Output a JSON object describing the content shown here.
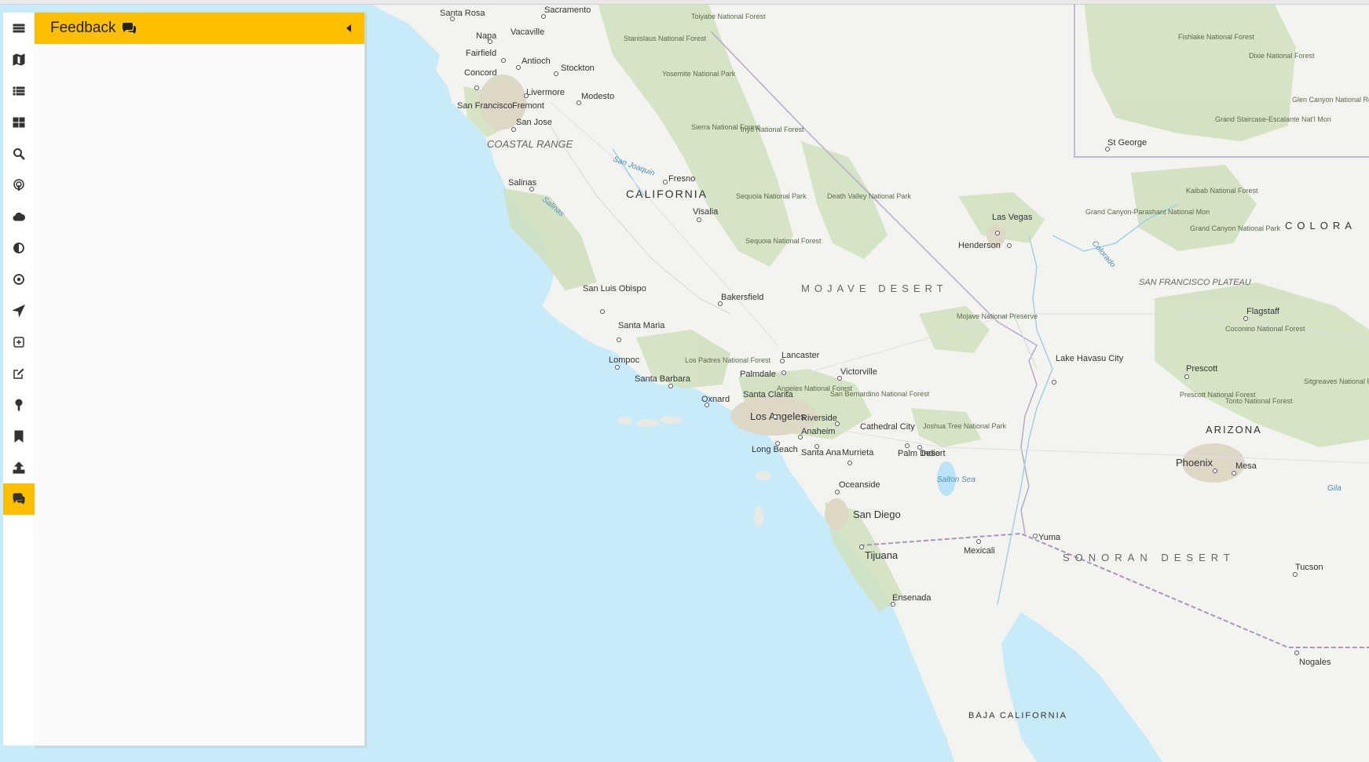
{
  "panel": {
    "title": "Feedback",
    "collapse_icon": "caret-left-icon",
    "title_icon": "comments-icon"
  },
  "toolbar": {
    "active_color": "#fdbf00",
    "items": [
      {
        "icon": "hamburger-menu-icon"
      },
      {
        "icon": "map-icon"
      },
      {
        "icon": "list-icon"
      },
      {
        "icon": "grid-icon"
      },
      {
        "icon": "search-icon"
      },
      {
        "icon": "podcast-icon"
      },
      {
        "icon": "cloud-icon"
      },
      {
        "icon": "contrast-icon"
      },
      {
        "icon": "target-icon"
      },
      {
        "icon": "location-arrow-icon"
      },
      {
        "icon": "plus-square-icon"
      },
      {
        "icon": "edit-icon"
      },
      {
        "icon": "map-pin-icon"
      },
      {
        "icon": "bookmark-icon"
      },
      {
        "icon": "upload-icon"
      },
      {
        "icon": "comments-icon",
        "active": true
      }
    ]
  },
  "map": {
    "region_labels": [
      "CALIFORNIA",
      "ARIZONA",
      "BAJA CALIFORNIA",
      "COLORA",
      "MOJAVE DESERT",
      "SONORAN DESERT",
      "COASTAL RANGE",
      "SAN FRANCISCO PLATEAU"
    ],
    "cities": [
      "Santa Rosa",
      "Sacramento",
      "Napa",
      "Vacaville",
      "Fairfield",
      "Antioch",
      "Stockton",
      "Concord",
      "Livermore",
      "Modesto",
      "San Francisco",
      "Fremont",
      "San Jose",
      "Salinas",
      "Fresno",
      "Visalia",
      "San Luis Obispo",
      "Bakersfield",
      "Santa Maria",
      "Lompoc",
      "Santa Barbara",
      "Oxnard",
      "Lancaster",
      "Palmdale",
      "Santa Clarita",
      "Victorville",
      "Los Angeles",
      "Riverside",
      "Anaheim",
      "Long Beach",
      "Santa Ana",
      "Murrieta",
      "Cathedral City",
      "Palm Desert",
      "Indio",
      "Oceanside",
      "San Diego",
      "Tijuana",
      "Mexicali",
      "Ensenada",
      "Yuma",
      "Las Vegas",
      "Henderson",
      "Lake Havasu City",
      "St George",
      "Flagstaff",
      "Prescott",
      "Phoenix",
      "Mesa",
      "Tucson",
      "Nogales"
    ],
    "parks": [
      "Stanislaus National Forest",
      "Toiyabe National Forest",
      "Yosemite National Park",
      "Sierra National Forest",
      "Inyo National Forest",
      "Sequoia National Park",
      "Sequoia National Forest",
      "Death Valley National Park",
      "Mojave National Preserve",
      "Los Padres National Forest",
      "Angeles National Forest",
      "San Bernardino National Forest",
      "Joshua Tree National Park",
      "Fishlake National Forest",
      "Dixie National Forest",
      "Glen Canyon National Rec Area",
      "Grand Staircase-Escalante Nat'l Mon",
      "Kaibab National Forest",
      "Grand Canyon-Parashant National Mon",
      "Grand Canyon National Park",
      "Coconino National Forest",
      "Prescott National Forest",
      "Tonto National Forest",
      "Sitgreaves National Forest"
    ],
    "water": [
      "San Joaquin",
      "Salinas",
      "Colorado",
      "Gila",
      "Salton Sea"
    ]
  }
}
